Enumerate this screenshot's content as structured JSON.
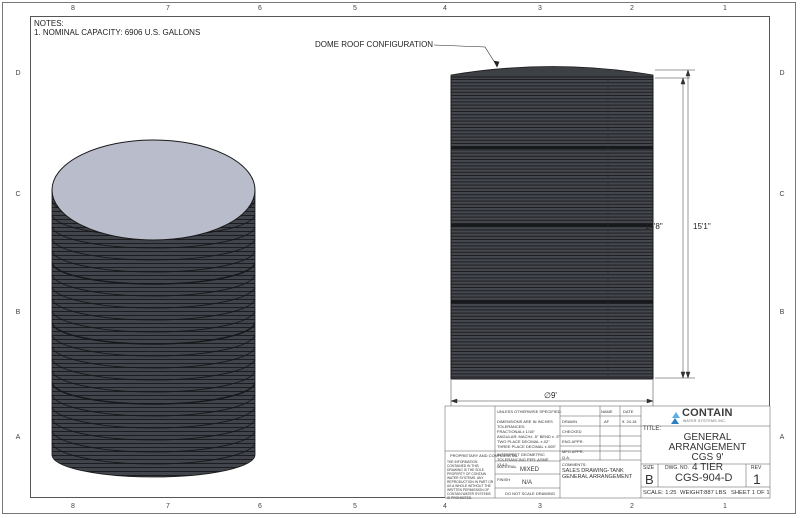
{
  "zones": {
    "columns": [
      "8",
      "7",
      "6",
      "5",
      "4",
      "3",
      "2",
      "1"
    ],
    "rows": [
      "D",
      "C",
      "B",
      "A"
    ]
  },
  "notes": {
    "heading": "NOTES:",
    "item1": "1. NOMINAL CAPACITY: 6906 U.S. GALLONS"
  },
  "callout": "DOME ROOF CONFIGURATION",
  "dimensions": {
    "eave_height": "14'8\"",
    "total_height": "15'1\"",
    "diameter": "9'"
  },
  "title_block": {
    "tolerances": {
      "header": "UNLESS OTHERWISE SPECIFIED:",
      "lines": [
        "DIMENSIONS ARE IN INCHES",
        "TOLERANCES:",
        "FRACTIONAL± 1/16\"",
        "ANGULAR: MACH± .5° BEND ± .5°",
        "TWO PLACE DECIMAL   ±.02\"",
        "THREE PLACE DECIMAL  ±.005\""
      ],
      "geometric": "INTERPRET GEOMETRIC TOLERANCING PER: ASME Y14.5",
      "material_label": "MATERIAL",
      "material_value": "MIXED",
      "finish_label": "FINISH",
      "finish_value": "N/A",
      "do_not_scale": "DO NOT SCALE DRAWING"
    },
    "proprietary": {
      "header": "PROPRIETARY AND CONFIDENTIAL",
      "body": "THE INFORMATION CONTAINED IN THIS DRAWING IS THE SOLE PROPERTY OF CONTAIN WATER SYSTEMS. ANY REPRODUCTION IN PART OR AS A WHOLE WITHOUT THE WRITTEN PERMISSION OF CONTAIN WATER SYSTEMS IS PROHIBITED."
    },
    "signoff": {
      "name_header": "NAME",
      "date_header": "DATE",
      "rows": [
        {
          "label": "DRAWN",
          "name": "AF",
          "date": "9. 24.18"
        },
        {
          "label": "CHECKED",
          "name": "",
          "date": ""
        },
        {
          "label": "ENG APPR.",
          "name": "",
          "date": ""
        },
        {
          "label": "MFG APPR.",
          "name": "",
          "date": ""
        },
        {
          "label": "Q.A.",
          "name": "",
          "date": ""
        }
      ],
      "comments_label": "COMMENTS:",
      "comments": [
        "SALES DRAWING-TANK",
        "GENERAL ARRANGEMENT"
      ]
    },
    "company": {
      "name": "CONTAIN",
      "tagline": "WATER SYSTEMS INC."
    },
    "title_label": "TITLE:",
    "title_lines": [
      "GENERAL ARRANGEMENT",
      "CGS 9'",
      "4 TIER"
    ],
    "size_label": "SIZE",
    "size_value": "B",
    "dwg_no_label": "DWG.  NO.",
    "dwg_no_value": "CGS-904-D",
    "rev_label": "REV",
    "rev_value": "1",
    "scale": "SCALE: 1:25",
    "weight": "WEIGHT:887 LBS",
    "sheet": "SHEET 1 OF 1"
  },
  "colors": {
    "tank_body": "#3f4247",
    "tank_top": "#b9bccb",
    "line": "#1a1a1a"
  }
}
